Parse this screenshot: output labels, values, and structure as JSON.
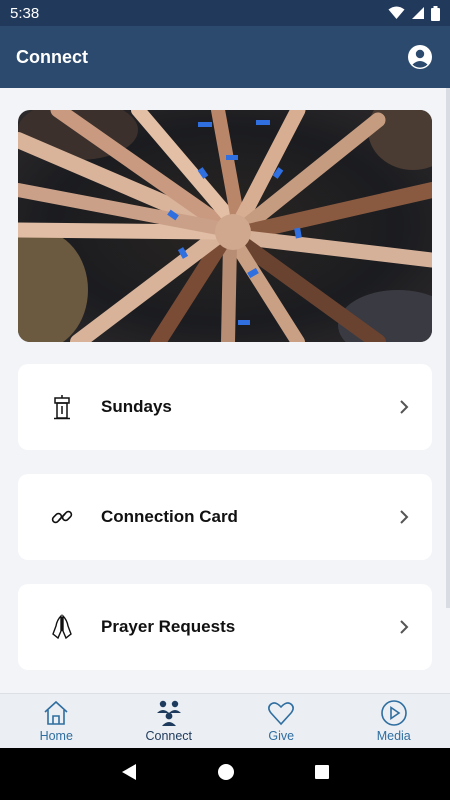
{
  "status_bar": {
    "time": "5:38",
    "icons": [
      "wifi-icon",
      "signal-icon",
      "battery-icon"
    ]
  },
  "app_bar": {
    "title": "Connect",
    "profile_icon": "account-circle-icon"
  },
  "hero": {
    "image": "hands-joined-in-circle-photo"
  },
  "cards": [
    {
      "label": "Sundays",
      "icon": "podium-icon"
    },
    {
      "label": "Connection Card",
      "icon": "link-icon"
    },
    {
      "label": "Prayer Requests",
      "icon": "praying-hands-icon"
    }
  ],
  "tabs": [
    {
      "label": "Home",
      "icon": "home-icon",
      "active": false
    },
    {
      "label": "Connect",
      "icon": "people-icon",
      "active": true
    },
    {
      "label": "Give",
      "icon": "heart-icon",
      "active": false
    },
    {
      "label": "Media",
      "icon": "play-circle-icon",
      "active": false
    }
  ],
  "colors": {
    "header": "#2b4a6e",
    "status_bar": "#213a5b",
    "tab_accent": "#2f6ea0",
    "background": "#f3f4f8"
  }
}
